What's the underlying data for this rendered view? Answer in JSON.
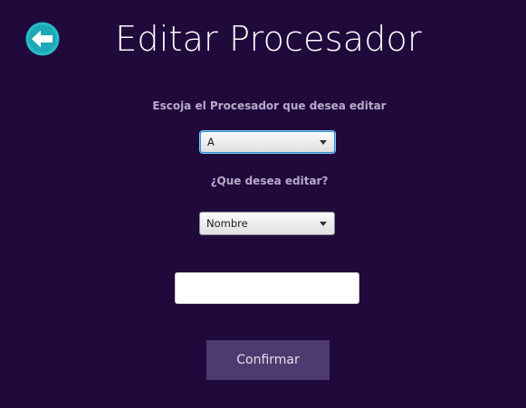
{
  "header": {
    "title": "Editar Procesador"
  },
  "form": {
    "processor_label": "Escoja el Procesador que desea editar",
    "processor_selected": "A",
    "field_label": "¿Que desea editar?",
    "field_selected": "Nombre",
    "value_input": "",
    "confirm_label": "Confirmar"
  },
  "colors": {
    "background": "#200a3c",
    "back_icon": "#27bcc8",
    "button": "#4d3a6e"
  }
}
